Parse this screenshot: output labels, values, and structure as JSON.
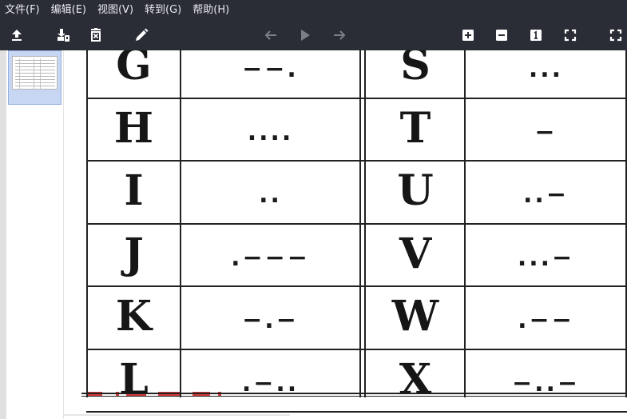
{
  "menu": {
    "items": [
      {
        "id": "file",
        "label": "文件(F)"
      },
      {
        "id": "edit",
        "label": "编辑(E)"
      },
      {
        "id": "view",
        "label": "视图(V)"
      },
      {
        "id": "goto",
        "label": "转到(G)"
      },
      {
        "id": "help",
        "label": "帮助(H)"
      }
    ]
  },
  "toolbar": {
    "buttons": [
      {
        "id": "open",
        "icon": "upload-icon",
        "enabled": true
      },
      {
        "id": "save",
        "icon": "save-to-disk-icon",
        "enabled": true
      },
      {
        "id": "delete",
        "icon": "delete-box-icon",
        "enabled": true
      },
      {
        "id": "edit",
        "icon": "pencil-icon",
        "enabled": true
      },
      {
        "id": "back",
        "icon": "arrow-left-icon",
        "enabled": false
      },
      {
        "id": "play",
        "icon": "play-icon",
        "enabled": false
      },
      {
        "id": "forward",
        "icon": "arrow-right-icon",
        "enabled": false
      },
      {
        "id": "zoom_in",
        "icon": "zoom-in-icon",
        "enabled": true
      },
      {
        "id": "zoom_out",
        "icon": "zoom-out-icon",
        "enabled": true
      },
      {
        "id": "actual_size",
        "icon": "actual-size-icon",
        "enabled": true
      },
      {
        "id": "fit_window",
        "icon": "fit-window-icon",
        "enabled": true
      },
      {
        "id": "fullscreen",
        "icon": "fullscreen-icon",
        "enabled": true
      }
    ]
  },
  "colors": {
    "chrome_bg": "#2b2d36",
    "menu_text": "#e9e9ee",
    "icon_active": "#ffffff",
    "icon_disabled": "#7c7f88",
    "thumb_selected": "#c6d6f3",
    "grid": "#222222"
  },
  "morse_table": {
    "rows": [
      {
        "left_letter": "G",
        "left_code": "−−.",
        "right_letter": "S",
        "right_code": "..."
      },
      {
        "left_letter": "H",
        "left_code": "....",
        "right_letter": "T",
        "right_code": "−"
      },
      {
        "left_letter": "I",
        "left_code": "..",
        "right_letter": "U",
        "right_code": "..−"
      },
      {
        "left_letter": "J",
        "left_code": ".−−−",
        "right_letter": "V",
        "right_code": "...−"
      },
      {
        "left_letter": "K",
        "left_code": "−.−",
        "right_letter": "W",
        "right_code": ".−−"
      },
      {
        "left_letter": "L",
        "left_code": ".−..",
        "right_letter": "X",
        "right_code": "−..−"
      }
    ]
  }
}
